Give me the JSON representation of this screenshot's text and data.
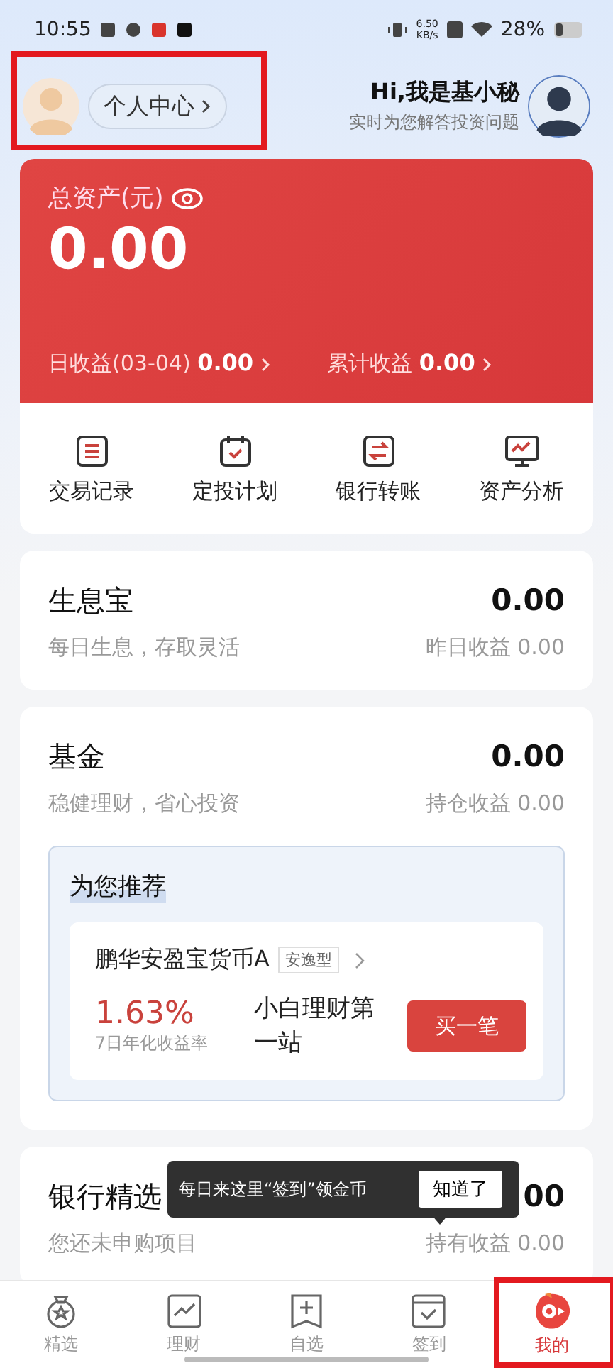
{
  "status_bar": {
    "time": "10:55",
    "net_speed_value": "6.50",
    "net_speed_unit": "KB/s",
    "battery": "28%"
  },
  "header": {
    "profile_button": "个人中心",
    "highlighted": true,
    "greeting": "Hi,我是基小秘",
    "subtitle": "实时为您解答投资问题"
  },
  "assets": {
    "label": "总资产(元)",
    "total": "0.00",
    "daily_label": "日收益(03-04)",
    "daily_value": "0.00",
    "cumulative_label": "累计收益",
    "cumulative_value": "0.00"
  },
  "quick_actions": [
    {
      "kind": "list",
      "label": "交易记录"
    },
    {
      "kind": "calendar",
      "label": "定投计划"
    },
    {
      "kind": "transfer",
      "label": "银行转账"
    },
    {
      "kind": "monitor",
      "label": "资产分析"
    }
  ],
  "products": [
    {
      "title": "生息宝",
      "subtitle": "每日生息，存取灵活",
      "value": "0.00",
      "meta": "昨日收益 0.00"
    },
    {
      "title": "基金",
      "subtitle": "稳健理财，省心投资",
      "value": "0.00",
      "meta": "持仓收益 0.00",
      "recommend": {
        "heading": "为您推荐",
        "fund": "鹏华安盈宝货币A",
        "tag": "安逸型",
        "rate": "1.63%",
        "rate_label": "7日年化收益率",
        "slogan": "小白理财第一站",
        "button": "买一笔"
      }
    },
    {
      "title": "银行精选",
      "subtitle": "您还未申购项目",
      "value": "00",
      "meta": "持有收益 0.00"
    }
  ],
  "tooltip": {
    "text": "每日来这里“签到”领金币",
    "button": "知道了"
  },
  "tabs": [
    {
      "kind": "medal",
      "label": "精选",
      "selected": false,
      "highlighted": false
    },
    {
      "kind": "chart",
      "label": "理财",
      "selected": false,
      "highlighted": false
    },
    {
      "kind": "add",
      "label": "自选",
      "selected": false,
      "highlighted": false
    },
    {
      "kind": "check",
      "label": "签到",
      "selected": false,
      "highlighted": false
    },
    {
      "kind": "mascot",
      "label": "我的",
      "selected": true,
      "highlighted": true
    }
  ]
}
